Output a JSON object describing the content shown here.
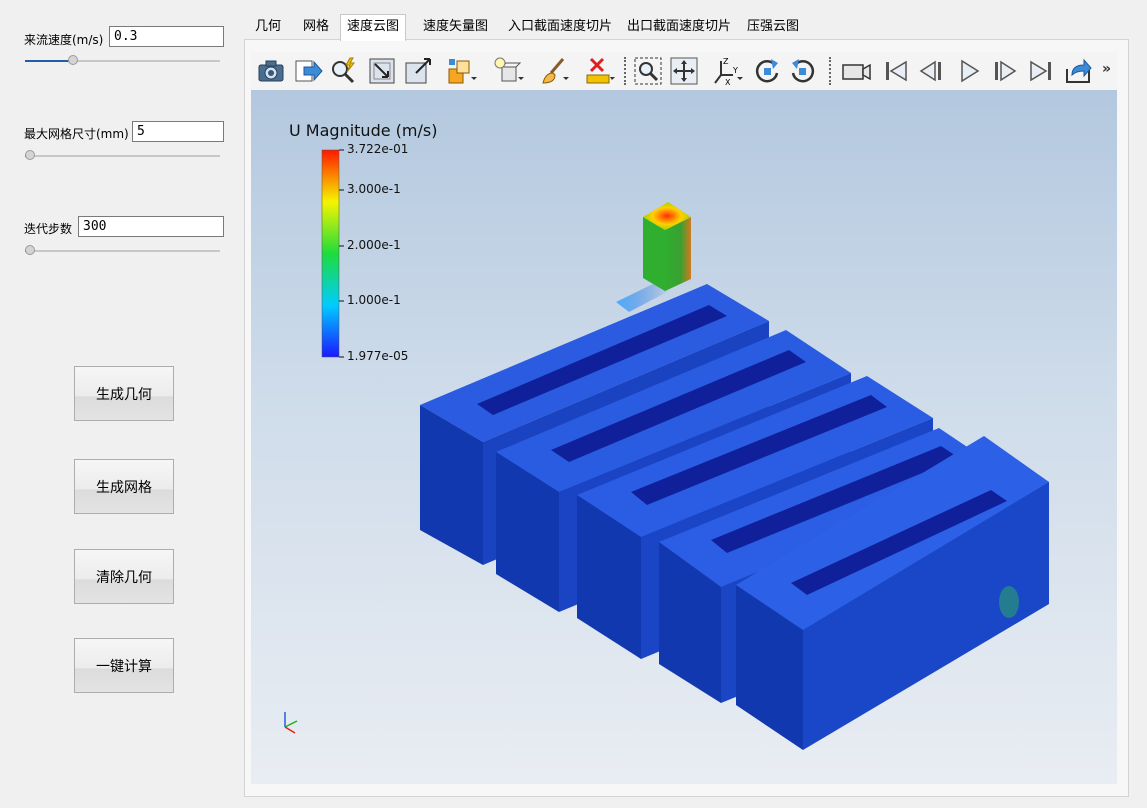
{
  "params": {
    "inflow_velocity": {
      "label": "来流速度(m/s)",
      "value": "0.3",
      "slider_fraction": 0.23
    },
    "max_mesh_size": {
      "label": "最大网格尺寸(mm)",
      "value": "5",
      "slider_fraction": 0.0
    },
    "iterations": {
      "label": "迭代步数",
      "value": "300",
      "slider_fraction": 0.0
    }
  },
  "buttons": {
    "generate_geometry": "生成几何",
    "generate_mesh": "生成网格",
    "clear_geometry": "清除几何",
    "one_click_compute": "一键计算"
  },
  "tabs": [
    {
      "label": "几何"
    },
    {
      "label": "网格"
    },
    {
      "label": "速度云图",
      "active": true
    },
    {
      "label": "速度矢量图"
    },
    {
      "label": "入口截面速度切片"
    },
    {
      "label": "出口截面速度切片"
    },
    {
      "label": "压强云图"
    }
  ],
  "toolbar": {
    "more": "»",
    "icons": [
      "camera-icon",
      "export-arrow-icon",
      "interactive-select-icon",
      "reset-camera-icon",
      "zoom-to-box-icon",
      "render-view-icon",
      "light-bulb-icon",
      "brush-icon",
      "clear-ruler-icon",
      "zoom-data-icon",
      "center-axes-icon",
      "axes-orientation-icon",
      "rotate-cw-icon",
      "rotate-ccw-icon",
      "video-camera-icon",
      "first-frame-icon",
      "previous-frame-icon",
      "play-icon",
      "next-frame-icon",
      "last-frame-icon",
      "share-icon"
    ]
  },
  "legend": {
    "title": "U Magnitude (m/s)",
    "ticks": [
      "3.722e-01",
      "3.000e-1",
      "2.000e-1",
      "1.000e-1",
      "1.977e-05"
    ]
  },
  "colors": {
    "accent": "#1f5fa8",
    "field_low": "#1431c8",
    "field_high": "#ff2000"
  }
}
